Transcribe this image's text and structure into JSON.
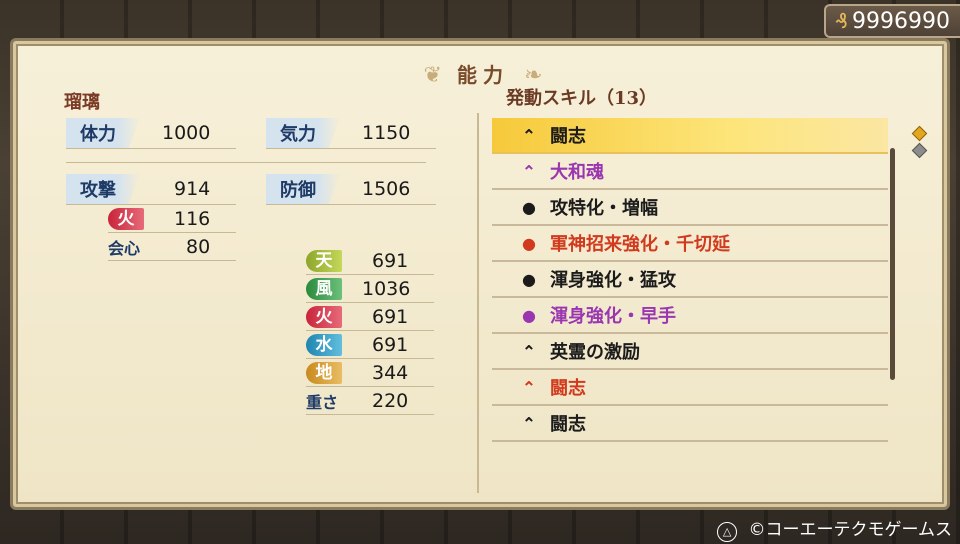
{
  "money": {
    "icon": "coin-icon",
    "value": "9996990"
  },
  "title": "能力",
  "character": "瑠璃",
  "stats": {
    "hp_label": "体力",
    "hp_value": "1000",
    "ki_label": "気力",
    "ki_value": "1150",
    "attack_label": "攻撃",
    "attack_value": "914",
    "defense_label": "防御",
    "defense_value": "1506",
    "atk_fire_label": "火",
    "atk_fire_value": "116",
    "crit_label": "会心",
    "crit_value": "80",
    "def_heaven_label": "天",
    "def_heaven_value": "691",
    "def_wind_label": "風",
    "def_wind_value": "1036",
    "def_fire_label": "火",
    "def_fire_value": "691",
    "def_water_label": "水",
    "def_water_value": "691",
    "def_earth_label": "地",
    "def_earth_value": "344",
    "weight_label": "重さ",
    "weight_value": "220"
  },
  "skills_header": "発動スキル（13）",
  "skills": [
    {
      "label": "闘志",
      "icon": "chevron-up-icon",
      "color": "black",
      "selected": true
    },
    {
      "label": "大和魂",
      "icon": "chevron-up-icon",
      "color": "purple"
    },
    {
      "label": "攻特化・増幅",
      "icon": "swirl-icon",
      "color": "black"
    },
    {
      "label": "軍神招来強化・千切延",
      "icon": "swirl-icon",
      "color": "red"
    },
    {
      "label": "渾身強化・猛攻",
      "icon": "swirl-icon",
      "color": "black"
    },
    {
      "label": "渾身強化・早手",
      "icon": "swirl-icon",
      "color": "purple"
    },
    {
      "label": "英霊の激励",
      "icon": "chevron-up-icon",
      "color": "black"
    },
    {
      "label": "闘志",
      "icon": "chevron-up-icon",
      "color": "red"
    },
    {
      "label": "闘志",
      "icon": "chevron-up-icon",
      "color": "black"
    }
  ],
  "footer": {
    "icon": "triangle-button-icon",
    "text": "©コーエーテクモゲームス"
  }
}
